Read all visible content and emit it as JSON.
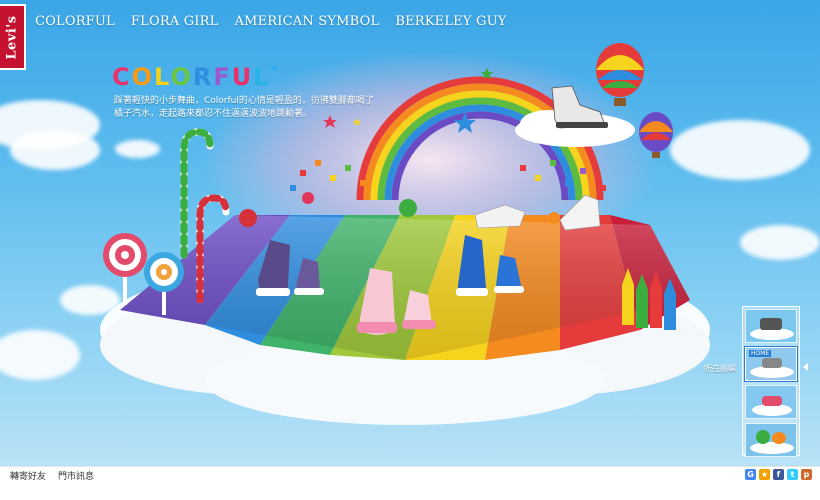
{
  "brand": {
    "logo_text": "Levi's",
    "color": "#c41230"
  },
  "nav": {
    "items": [
      {
        "label": "COLORFUL"
      },
      {
        "label": "FLORA GIRL"
      },
      {
        "label": "AMERICAN SYMBOL"
      },
      {
        "label": "BERKELEY GUY"
      }
    ]
  },
  "hero": {
    "title_letters": [
      "C",
      "O",
      "L",
      "O",
      "R",
      "F",
      "U",
      "L"
    ],
    "title_star": "*",
    "description_line1": "踩著輕快的小步舞曲，Colorful的心情是輕盈的，彷彿雙腳都喝了",
    "description_line2": "橘子汽水，走起路來都忍不住邁邁波波地跳動著。"
  },
  "side_panel": {
    "label": "所在島嶼",
    "thumbnails": [
      {
        "name": "island-1"
      },
      {
        "name": "island-2",
        "badge": "HOME"
      },
      {
        "name": "island-3"
      },
      {
        "name": "island-4"
      }
    ],
    "active_index": 1
  },
  "footer": {
    "links": [
      {
        "label": "轉寄好友"
      },
      {
        "label": "門市訊息"
      }
    ],
    "share_icons": [
      {
        "icon": "google-icon",
        "glyph": "G",
        "color": "#4285f4"
      },
      {
        "icon": "star-icon",
        "glyph": "★",
        "color": "#f2a100"
      },
      {
        "icon": "facebook-icon",
        "glyph": "f",
        "color": "#3b5998"
      },
      {
        "icon": "twitter-icon",
        "glyph": "t",
        "color": "#33ccff"
      },
      {
        "icon": "plurk-icon",
        "glyph": "p",
        "color": "#cf682f"
      }
    ]
  },
  "colors": {
    "sky_top": "#3aa6e6",
    "rainbow": [
      "#e63b3b",
      "#f58a1f",
      "#f6d31c",
      "#5dbb3f",
      "#2f8de0",
      "#6b4bc4"
    ]
  }
}
